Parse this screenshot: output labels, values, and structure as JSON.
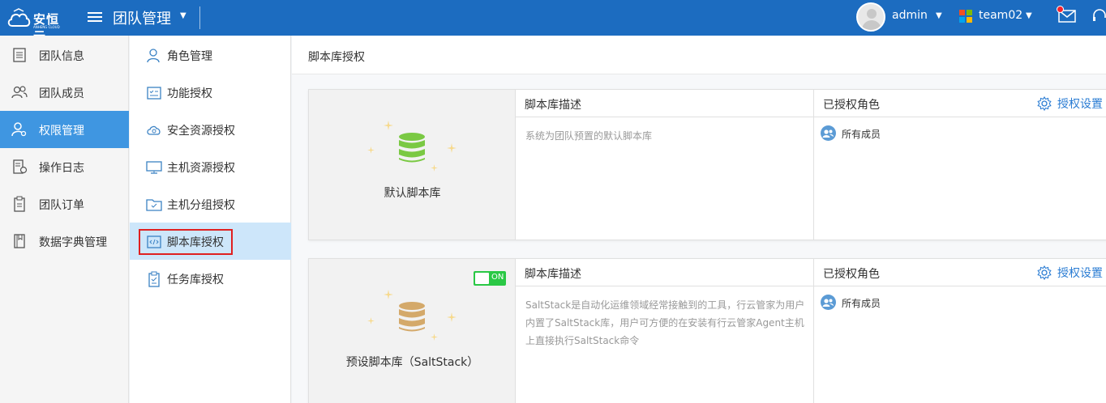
{
  "topbar": {
    "logo_text": "安恒云",
    "logo_sub": "ANHENG CLOUD",
    "app_title": "团队管理",
    "user_name": "admin",
    "team_name": "team02"
  },
  "leftnav": [
    {
      "label": "团队信息",
      "icon": "document-icon"
    },
    {
      "label": "团队成员",
      "icon": "users-icon"
    },
    {
      "label": "权限管理",
      "icon": "user-key-icon",
      "active": true
    },
    {
      "label": "操作日志",
      "icon": "log-icon"
    },
    {
      "label": "团队订单",
      "icon": "clipboard-icon"
    },
    {
      "label": "数据字典管理",
      "icon": "book-icon"
    }
  ],
  "subnav": [
    {
      "label": "角色管理",
      "icon": "user-icon"
    },
    {
      "label": "功能授权",
      "icon": "checklist-icon"
    },
    {
      "label": "安全资源授权",
      "icon": "cloud-icon"
    },
    {
      "label": "主机资源授权",
      "icon": "monitor-icon"
    },
    {
      "label": "主机分组授权",
      "icon": "folder-icon"
    },
    {
      "label": "脚本库授权",
      "icon": "code-icon",
      "active": true
    },
    {
      "label": "任务库授权",
      "icon": "task-icon"
    }
  ],
  "main": {
    "page_title": "脚本库授权",
    "cards": [
      {
        "name": "默认脚本库",
        "db_color": "#7ac943",
        "desc_header": "脚本库描述",
        "description": "系统为团队预置的默认脚本库",
        "roles_header": "已授权角色",
        "auth_button": "授权设置",
        "role": "所有成员"
      },
      {
        "name": "预设脚本库（SaltStack）",
        "db_color": "#d4a96a",
        "toggle_label": "ON",
        "desc_header": "脚本库描述",
        "description": "SaltStack是自动化运维领域经常接触到的工具，行云管家为用户内置了SaltStack库，用户可方便的在安装有行云管家Agent主机上直接执行SaltStack命令",
        "roles_header": "已授权角色",
        "auth_button": "授权设置",
        "role": "所有成员"
      }
    ]
  },
  "colors": {
    "topbar": "#1c6cc0",
    "nav_active": "#3f96e1",
    "subnav_active": "#cde6fa",
    "link": "#2a7cd3",
    "toggle_on": "#2ac845",
    "highlight": "#e02020"
  }
}
